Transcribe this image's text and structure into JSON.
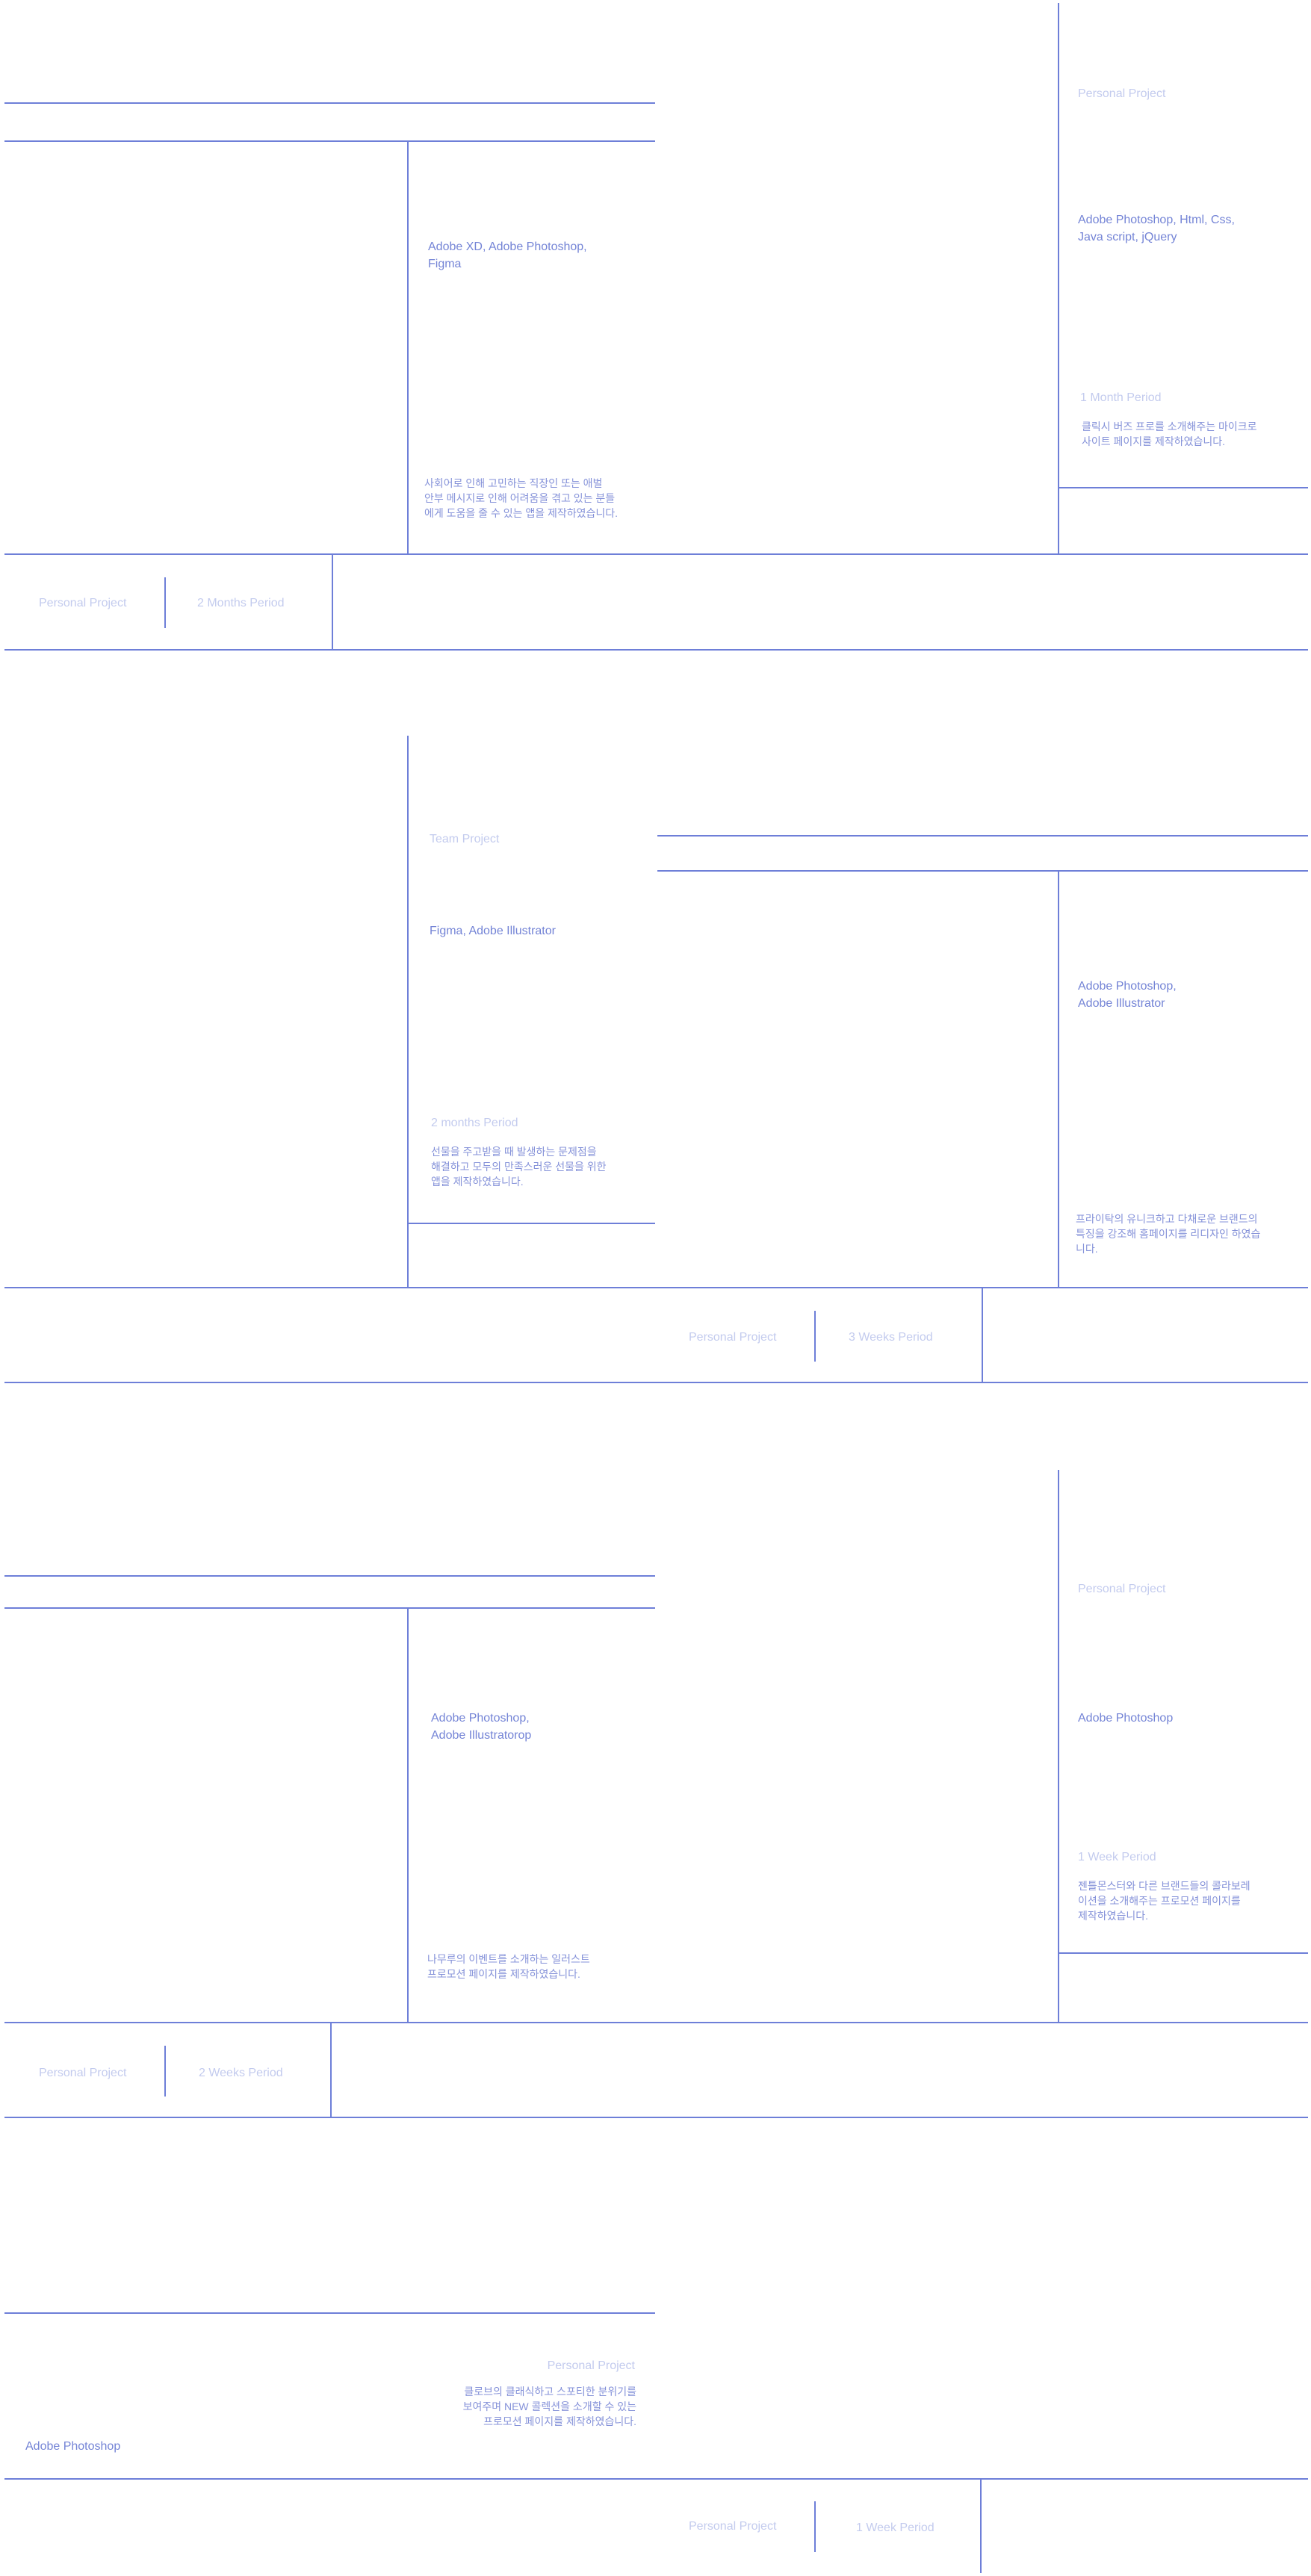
{
  "projects": [
    {
      "type": "Personal Project",
      "tools": "Adobe XD, Adobe  Photoshop,\nFigma",
      "description": "사회어로 인해 고민하는 직장인 또는 애벌\n안부 메시지로 인해 어려움을 겪고 있는 분들\n에게 도움을 줄 수 있는 앱을 제작하였습니다.",
      "period": "2 Months Period"
    },
    {
      "type": "Personal Project",
      "tools": "Adobe  Photoshop, Html, Css,\nJava script, jQuery",
      "period": "1 Month Period",
      "description": "클릭시 버즈 프로를 소개해주는 마이크로\n사이트 페이지를 제작하였습니다."
    },
    {
      "type": "Team Project",
      "tools": "Figma, Adobe Illustrator",
      "period": "2 months Period",
      "description": "선물을 주고받을 때 발생하는 문제점을\n해결하고 모두의 만족스러운 선물을 위한\n앱을 제작하였습니다."
    },
    {
      "type": "Personal Project",
      "tools": "Adobe Photoshop,\nAdobe Illustrator",
      "description": "프라이탁의 유니크하고 다채로운 브랜드의\n특징을 강조해 홈페이지를 리디자인 하였습\n니다.",
      "period": "3 Weeks Period"
    },
    {
      "type": "Personal Project",
      "tools": "Adobe  Photoshop,\nAdobe Illustratorop",
      "description": "나무루의 이벤트를 소개하는 일러스트\n프로모션 페이지를 제작하였습니다.",
      "period": "2 Weeks Period"
    },
    {
      "type": "Personal Project",
      "tools": "Adobe  Photoshop",
      "period": "1 Week Period",
      "description": "젠틀몬스터와 다른 브랜드들의 콜라보레\n이션을 소개해주는 프로모션 페이지를\n제작하였습니다."
    },
    {
      "type": "Personal Project",
      "description": "클로브의 클래식하고 스포티한 분위기를\n보여주며 NEW 콜렉션을 소개할 수 있는\n프로모션 페이지를 제작하였습니다.",
      "tools": "Adobe  Photoshop",
      "period": "1 Week Period"
    }
  ],
  "colors": {
    "line": "#6e7fd8",
    "muted_text": "#c3cbee",
    "tools_text": "#7484d6",
    "description_text": "#8592d9",
    "background": "#ffffff"
  }
}
